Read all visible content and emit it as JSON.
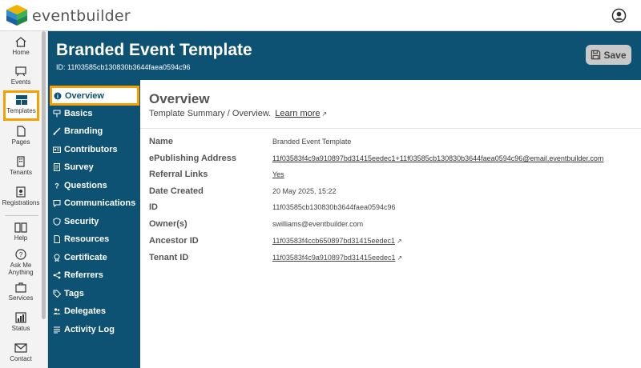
{
  "app": {
    "brand": "eventbuilder"
  },
  "rail": {
    "items": [
      {
        "label": "Home"
      },
      {
        "label": "Events"
      },
      {
        "label": "Templates"
      },
      {
        "label": "Pages"
      },
      {
        "label": "Tenants"
      },
      {
        "label": "Registrations"
      },
      {
        "label": "Help"
      },
      {
        "label": "Ask Me Anything"
      },
      {
        "label": "Services"
      },
      {
        "label": "Status"
      },
      {
        "label": "Contact"
      }
    ]
  },
  "header": {
    "title": "Branded Event Template",
    "id_text": "ID: 11f03585cb130830b3644faea0594c96",
    "save_label": "Save"
  },
  "sections": [
    {
      "label": "Overview",
      "icon": "info-icon"
    },
    {
      "label": "Basics",
      "icon": "sign-icon"
    },
    {
      "label": "Branding",
      "icon": "brush-icon"
    },
    {
      "label": "Contributors",
      "icon": "id-card-icon"
    },
    {
      "label": "Survey",
      "icon": "form-icon"
    },
    {
      "label": "Questions",
      "icon": "question-icon"
    },
    {
      "label": "Communications",
      "icon": "chat-icon"
    },
    {
      "label": "Security",
      "icon": "shield-icon"
    },
    {
      "label": "Resources",
      "icon": "document-icon"
    },
    {
      "label": "Certificate",
      "icon": "certificate-icon"
    },
    {
      "label": "Referrers",
      "icon": "share-icon"
    },
    {
      "label": "Tags",
      "icon": "tag-icon"
    },
    {
      "label": "Delegates",
      "icon": "people-icon"
    },
    {
      "label": "Activity Log",
      "icon": "list-icon"
    }
  ],
  "overview": {
    "title": "Overview",
    "subtitle": "Template Summary / Overview.",
    "learn_more": "Learn more",
    "fields": [
      {
        "label": "Name",
        "value": "Branded Event Template"
      },
      {
        "label": "ePublishing Address",
        "value": "11f03583f4c9a910897bd31415eedec1+11f03585cb130830b3644faea0594c96@email.eventbuilder.com"
      },
      {
        "label": "Referral Links",
        "value": "Yes"
      },
      {
        "label": "Date Created",
        "value": "20 May 2025, 15:22"
      },
      {
        "label": "ID",
        "value": "11f03585cb130830b3644faea0594c96"
      },
      {
        "label": "Owner(s)",
        "value": "swilliams@eventbuilder.com"
      },
      {
        "label": "Ancestor ID",
        "value": "11f03583f4ccb650897bd31415eedec1"
      },
      {
        "label": "Tenant ID",
        "value": "11f03583f4c9a910897bd31415eedec1"
      }
    ]
  },
  "colors": {
    "primary": "#0d5173",
    "highlight": "#f5a000"
  }
}
